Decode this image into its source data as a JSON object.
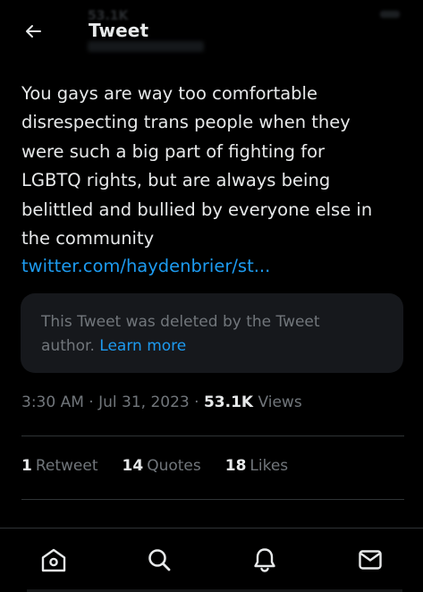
{
  "header": {
    "title": "Tweet",
    "back_icon": "arrow-left-icon",
    "ghost_count": "53.1K"
  },
  "tweet": {
    "text_lines": [
      "You gays are way too comfortable",
      "disrespecting trans people when they",
      "were such a big part of fighting for",
      "LGBTQ rights, but are always being",
      "belittled and bullied by everyone else in",
      "the community"
    ],
    "link": "twitter.com/haydenbrier/st..."
  },
  "deleted_quote": {
    "line1": "This Tweet was deleted by the Tweet",
    "line2_prefix": "author.",
    "learn_more": "Learn more"
  },
  "meta": {
    "time": "3:30 AM",
    "separator": "·",
    "date": "Jul 31, 2023",
    "views_count": "53.1K",
    "views_label": "Views"
  },
  "stats": [
    {
      "count": "1",
      "label": "Retweet"
    },
    {
      "count": "14",
      "label": "Quotes"
    },
    {
      "count": "18",
      "label": "Likes"
    }
  ],
  "bottom_nav": {
    "items": [
      "home-icon",
      "search-icon",
      "notifications-bell-icon",
      "messages-mail-icon"
    ]
  },
  "colors": {
    "background": "#000000",
    "text_primary": "#e7e9ea",
    "text_secondary": "#71767b",
    "accent": "#1d9bf0",
    "card_bg": "#16181c",
    "divider": "#2f3336"
  }
}
